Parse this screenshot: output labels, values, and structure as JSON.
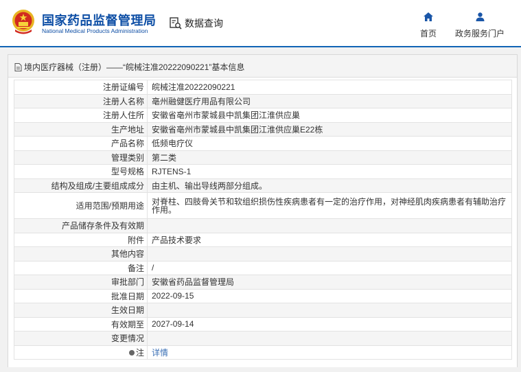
{
  "header": {
    "brand_cn": "国家药品监督管理局",
    "brand_en": "National Medical Products Administration",
    "query_label": "数据查询",
    "nav": [
      {
        "label": "首页",
        "icon": "home-icon"
      },
      {
        "label": "政务服务门户",
        "icon": "user-icon"
      }
    ],
    "accent_color": "#0f63b5"
  },
  "panel": {
    "title": "境内医疗器械（注册）——“皖械注准20222090221”基本信息"
  },
  "fields": [
    {
      "label": "注册证编号",
      "value": "皖械注准20222090221"
    },
    {
      "label": "注册人名称",
      "value": "亳州融健医疗用品有限公司"
    },
    {
      "label": "注册人住所",
      "value": "安徽省亳州市蒙城县中凯集团江淮供应巢"
    },
    {
      "label": "生产地址",
      "value": "安徽省亳州市蒙城县中凯集团江淮供应巢E22栋"
    },
    {
      "label": "产品名称",
      "value": "低频电疗仪"
    },
    {
      "label": "管理类别",
      "value": "第二类"
    },
    {
      "label": "型号规格",
      "value": "RJTENS-1"
    },
    {
      "label": "结构及组成/主要组成成分",
      "value": "由主机、输出导线两部分组成。"
    },
    {
      "label": "适用范围/预期用途",
      "value": "对脊柱、四肢骨关节和软组织损伤性疾病患者有一定的治疗作用，对神经肌肉疾病患者有辅助治疗作用。"
    },
    {
      "label": "产品储存条件及有效期",
      "value": ""
    },
    {
      "label": "附件",
      "value": "产品技术要求"
    },
    {
      "label": "其他内容",
      "value": ""
    },
    {
      "label": "备注",
      "value": "/"
    },
    {
      "label": "审批部门",
      "value": "安徽省药品监督管理局"
    },
    {
      "label": "批准日期",
      "value": "2022-09-15"
    },
    {
      "label": "生效日期",
      "value": ""
    },
    {
      "label": "有效期至",
      "value": "2027-09-14"
    },
    {
      "label": "变更情况",
      "value": ""
    },
    {
      "label": "注",
      "value": "详情"
    }
  ]
}
